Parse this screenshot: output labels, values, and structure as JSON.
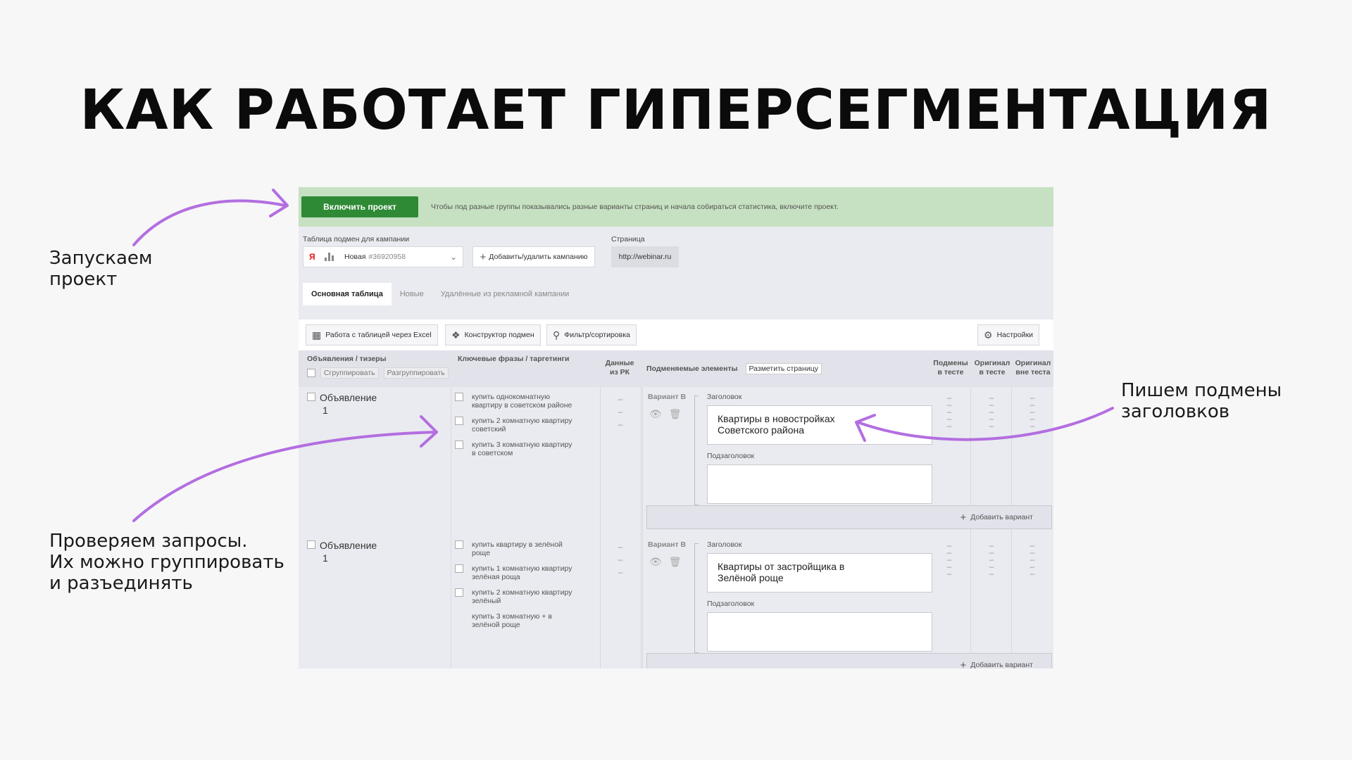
{
  "slide": {
    "title": "КАК РАБОТАЕТ ГИПЕРСЕГМЕНТАЦИЯ",
    "notes": {
      "launch": [
        "Запускаем",
        "проект"
      ],
      "queries": [
        "Проверяем запросы.",
        "Их можно группировать",
        "и разъединять"
      ],
      "headlines": [
        "Пишем подмены",
        "заголовков"
      ]
    },
    "arrow_color": "#b36ee0"
  },
  "app": {
    "enable_button": "Включить проект",
    "enable_message": "Чтобы под разные группы показывались разные варианты страниц и начала собираться статистика, включите проект.",
    "campaign_label": "Таблица подмен для кампании",
    "campaign_icon": "Я",
    "campaign_name": "Новая",
    "campaign_id": "#36920958",
    "add_campaign": "Добавить/удалить кампанию",
    "page_label": "Страница",
    "page_url": "http://webinar.ru",
    "tabs": [
      "Основная таблица",
      "Новые",
      "Удалённые из рекламной кампании"
    ],
    "toolbar": {
      "excel": "Работа с таблицей через Excel",
      "constructor": "Конструктор подмен",
      "filter": "Фильтр/сортировка",
      "settings": "Настройки"
    },
    "columns": {
      "ads": "Объявления / тизеры",
      "group": "Сгруппировать",
      "ungroup": "Разгруппировать",
      "keywords": "Ключевые фразы / таргетинги",
      "rk_data": [
        "Данные",
        "из РК"
      ],
      "elements": "Подменяемые элементы",
      "mark_page": "Разметить страницу",
      "in_test": [
        "Подмены",
        "в тесте"
      ],
      "orig_in_test": [
        "Оригинал",
        "в тесте"
      ],
      "orig_out_test": [
        "Оригинал",
        "вне теста"
      ]
    },
    "rows": [
      {
        "ad_title": "Объявление",
        "ad_num": "1",
        "keywords": [
          [
            "купить однокомнатную",
            "квартиру в советском районе"
          ],
          [
            "купить 2 комнатную квартиру",
            "советский"
          ],
          [
            "купить 3 комнатную квартиру",
            "в советском"
          ]
        ],
        "variant": "Вариант B",
        "headline_label": "Заголовок",
        "headline": [
          "Квартиры в новостройках",
          "Советского района"
        ],
        "subheadline_label": "Подзаголовок",
        "add_variant": "Добавить вариант"
      },
      {
        "ad_title": "Объявление",
        "ad_num": "1",
        "keywords": [
          [
            "купить квартиру в зелёной",
            "роще"
          ],
          [
            "купить 1 комнатную квартиру",
            "зелёная роща"
          ],
          [
            "купить 2 комнатную квартиру",
            "зелёный"
          ],
          [
            "купить 3 комнатную + в",
            "зелёной роще"
          ]
        ],
        "variant": "Вариант B",
        "headline_label": "Заголовок",
        "headline": [
          "Квартиры от застройщика в",
          "Зелёной роще"
        ],
        "subheadline_label": "Подзаголовок",
        "add_variant": "Добавить вариант"
      }
    ],
    "dash": "–",
    "colors": {
      "enable_bg": "#2f8a36",
      "topbar_bg": "#c6e1c1",
      "panel_bg": "#eaebf0"
    }
  }
}
